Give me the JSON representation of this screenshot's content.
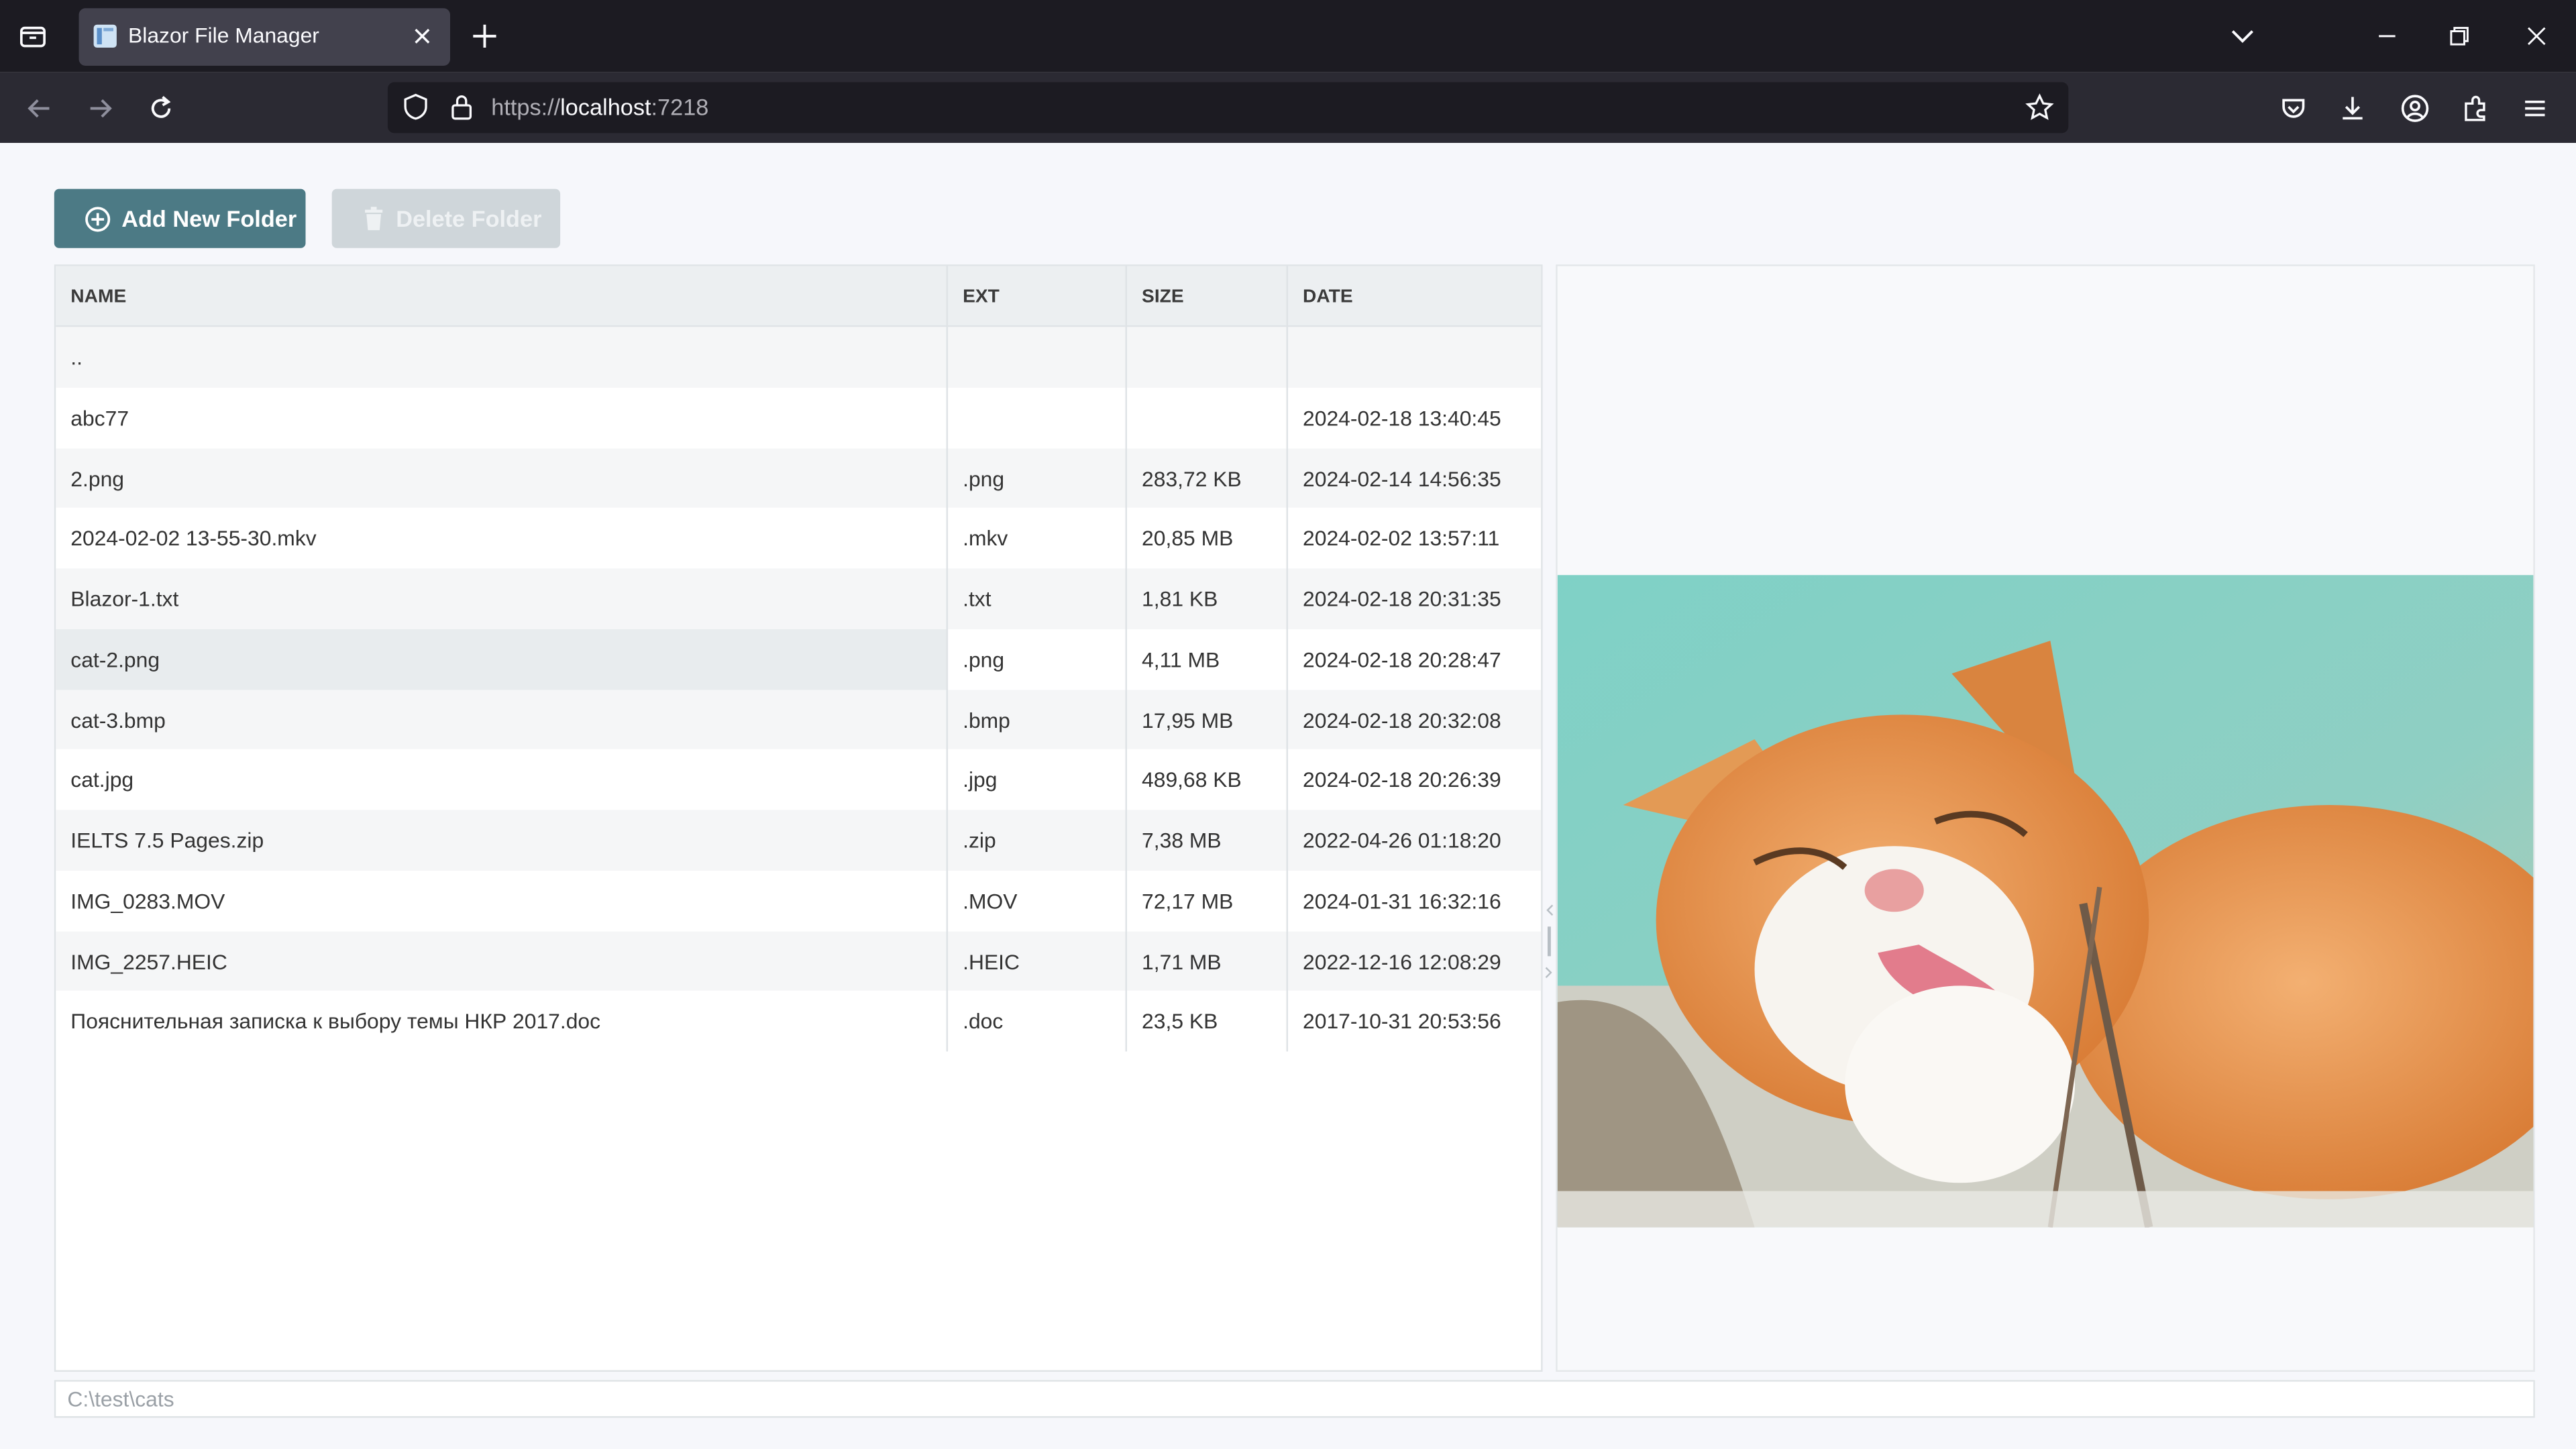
{
  "browser": {
    "tab_title": "Blazor File Manager",
    "url_scheme": "https://",
    "url_host": "localhost",
    "url_port": ":7218"
  },
  "toolbar": {
    "add_folder_label": "Add New Folder",
    "delete_folder_label": "Delete Folder"
  },
  "grid": {
    "columns": [
      "NAME",
      "EXT",
      "SIZE",
      "DATE"
    ],
    "rows": [
      {
        "name": "..",
        "ext": "",
        "size": "",
        "date": ""
      },
      {
        "name": "abc77",
        "ext": "",
        "size": "",
        "date": "2024-02-18 13:40:45"
      },
      {
        "name": "2.png",
        "ext": ".png",
        "size": "283,72 KB",
        "date": "2024-02-14 14:56:35"
      },
      {
        "name": "2024-02-02 13-55-30.mkv",
        "ext": ".mkv",
        "size": "20,85 MB",
        "date": "2024-02-02 13:57:11"
      },
      {
        "name": "Blazor-1.txt",
        "ext": ".txt",
        "size": "1,81 KB",
        "date": "2024-02-18 20:31:35"
      },
      {
        "name": "cat-2.png",
        "ext": ".png",
        "size": "4,11 MB",
        "date": "2024-02-18 20:28:47"
      },
      {
        "name": "cat-3.bmp",
        "ext": ".bmp",
        "size": "17,95 MB",
        "date": "2024-02-18 20:32:08"
      },
      {
        "name": "cat.jpg",
        "ext": ".jpg",
        "size": "489,68 KB",
        "date": "2024-02-18 20:26:39"
      },
      {
        "name": "IELTS 7.5 Pages.zip",
        "ext": ".zip",
        "size": "7,38 MB",
        "date": "2022-04-26 01:18:20"
      },
      {
        "name": "IMG_0283.MOV",
        "ext": ".MOV",
        "size": "72,17 MB",
        "date": "2024-01-31 16:32:16"
      },
      {
        "name": "IMG_2257.HEIC",
        "ext": ".HEIC",
        "size": "1,71 MB",
        "date": "2022-12-16 12:08:29"
      },
      {
        "name": "Пояснительная записка к выбору темы НКР 2017.doc",
        "ext": ".doc",
        "size": "23,5 KB",
        "date": "2017-10-31 20:53:56"
      }
    ],
    "selected_row": 5
  },
  "status": {
    "current_path": "C:\\test\\cats"
  },
  "colors": {
    "primary_button": "#4c7a85",
    "disabled_button": "#cfd6da",
    "tabbar": "#1c1b22",
    "navbar": "#2b2a33"
  }
}
